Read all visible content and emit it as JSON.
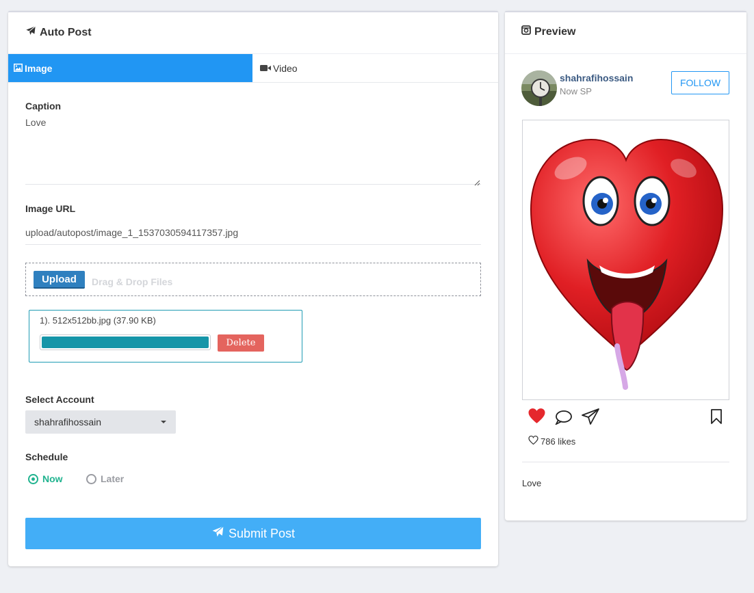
{
  "auto_post": {
    "title": "Auto Post",
    "tabs": [
      {
        "label": "Image",
        "active": true
      },
      {
        "label": "Video",
        "active": false
      }
    ],
    "caption": {
      "label": "Caption",
      "value": "Love"
    },
    "image_url": {
      "label": "Image URL",
      "value": "upload/autopost/image_1_1537030594117357.jpg"
    },
    "upload": {
      "button_label": "Upload",
      "drop_text": "Drag & Drop Files"
    },
    "file": {
      "name": "1). 512x512bb.jpg (37.90 KB)",
      "progress_percent": 100,
      "delete_label": "Delete"
    },
    "account": {
      "label": "Select Account",
      "selected": "shahrafihossain"
    },
    "schedule": {
      "label": "Schedule",
      "options": [
        {
          "label": "Now",
          "selected": true
        },
        {
          "label": "Later",
          "selected": false
        }
      ]
    },
    "submit_label": "Submit Post"
  },
  "preview": {
    "title": "Preview",
    "username": "shahrafihossain",
    "subtext": "Now SP",
    "follow_label": "FOLLOW",
    "likes": "786 likes",
    "caption": "Love"
  },
  "colors": {
    "accent": "#2196f3",
    "submit": "#43aef7",
    "success": "#20b38f",
    "danger": "#e4645e",
    "progress": "#1595a8",
    "heart": "#e5282d"
  }
}
